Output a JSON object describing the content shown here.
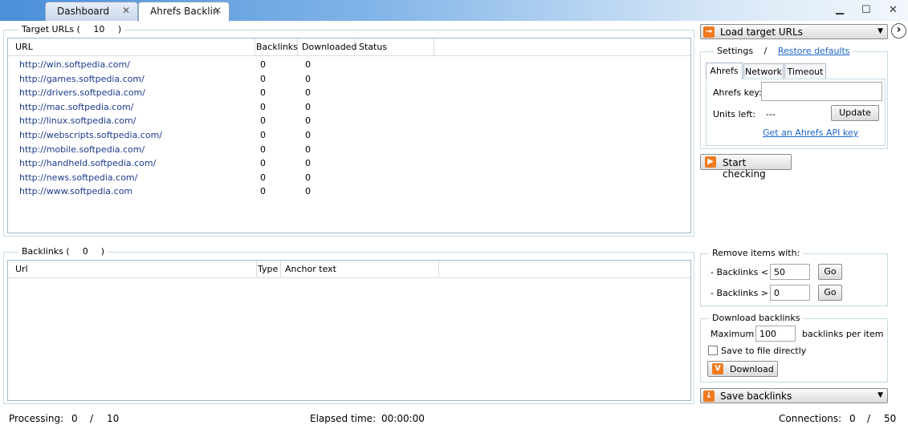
{
  "tabs": [
    {
      "label": "Dashboard",
      "close": "✕"
    },
    {
      "label": "Ahrefs Backlin",
      "close": "✕"
    }
  ],
  "window_controls": {
    "minimize": "▁",
    "maximize": "☐",
    "close": "✕"
  },
  "target_urls": {
    "title_prefix": "Target URLs (",
    "count": "10",
    "title_suffix": ")",
    "columns": [
      "URL",
      "Backlinks",
      "Downloaded",
      "Status"
    ],
    "rows": [
      {
        "url": "http://win.softpedia.com/",
        "backlinks": "0",
        "downloaded": "0",
        "status": ""
      },
      {
        "url": "http://games.softpedia.com/",
        "backlinks": "0",
        "downloaded": "0",
        "status": ""
      },
      {
        "url": "http://drivers.softpedia.com/",
        "backlinks": "0",
        "downloaded": "0",
        "status": ""
      },
      {
        "url": "http://mac.softpedia.com/",
        "backlinks": "0",
        "downloaded": "0",
        "status": ""
      },
      {
        "url": "http://linux.softpedia.com/",
        "backlinks": "0",
        "downloaded": "0",
        "status": ""
      },
      {
        "url": "http://webscripts.softpedia.com/",
        "backlinks": "0",
        "downloaded": "0",
        "status": ""
      },
      {
        "url": "http://mobile.softpedia.com/",
        "backlinks": "0",
        "downloaded": "0",
        "status": ""
      },
      {
        "url": "http://handheld.softpedia.com/",
        "backlinks": "0",
        "downloaded": "0",
        "status": ""
      },
      {
        "url": "http://news.softpedia.com/",
        "backlinks": "0",
        "downloaded": "0",
        "status": ""
      },
      {
        "url": "http://www.softpedia.com",
        "backlinks": "0",
        "downloaded": "0",
        "status": ""
      }
    ]
  },
  "backlinks": {
    "title_prefix": "Backlinks (",
    "count": "0",
    "title_suffix": ")",
    "columns": [
      "Url",
      "Type",
      "Anchor text"
    ]
  },
  "right": {
    "load_button": "Load target URLs",
    "next_arrow": "›",
    "settings_label": "Settings",
    "slash": "/",
    "restore_defaults": "Restore defaults",
    "subtabs": [
      "Ahrefs",
      "Network",
      "Timeout"
    ],
    "ahrefs_key_label": "Ahrefs key:",
    "ahrefs_key_value": "",
    "units_left_label": "Units left:",
    "units_left_value": "---",
    "update_button": "Update",
    "get_api_key": "Get an Ahrefs API key",
    "start_button": "Start checking",
    "remove_title": "Remove items with:",
    "remove_lt_label": "- Backlinks  <",
    "remove_lt_value": "50",
    "remove_gt_label": "- Backlinks  >",
    "remove_gt_value": "0",
    "go_label": "Go",
    "download_title": "Download backlinks",
    "maximum_label": "Maximum",
    "maximum_value": "100",
    "per_item_label": "backlinks per item",
    "save_direct_label": "Save to file directly",
    "download_button": "Download",
    "save_backlinks": "Save backlinks"
  },
  "status": {
    "processing_label": "Processing:",
    "processing_done": "0",
    "processing_sep": "/",
    "processing_total": "10",
    "elapsed_label": "Elapsed time:",
    "elapsed_value": "00:00:00",
    "connections_label": "Connections:",
    "connections_active": "0",
    "connections_sep": "/",
    "connections_total": "50"
  },
  "colors": {
    "accent_orange": "#f07a1e",
    "link_blue": "#1a64c8",
    "url_blue": "#1a3a8c"
  }
}
